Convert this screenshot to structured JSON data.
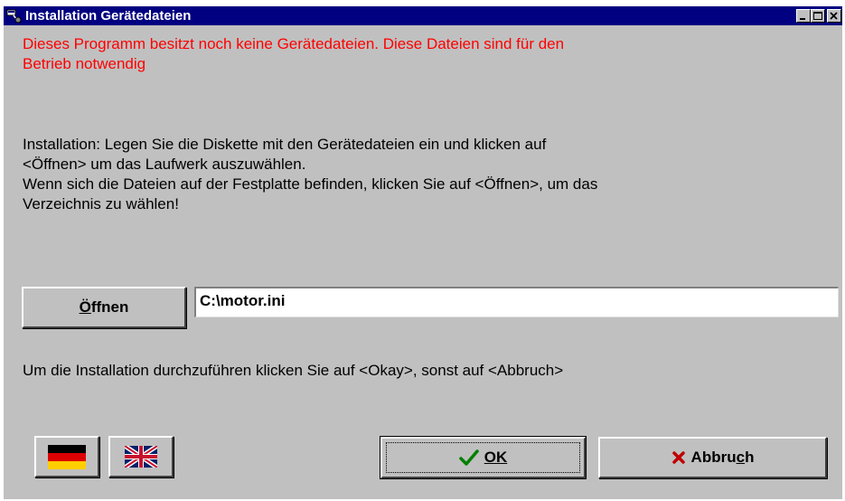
{
  "window": {
    "title": "Installation Gerätedateien",
    "minimize_icon": "minimize-icon",
    "maximize_icon": "maximize-icon",
    "close_icon": "close-icon"
  },
  "warning": {
    "line1": "Dieses Programm besitzt noch keine Gerätedateien. Diese Dateien sind für den",
    "line2": "Betrieb notwendig"
  },
  "instructions": {
    "line1": "Installation: Legen Sie die Diskette mit den Gerätedateien ein und klicken auf",
    "line2": "<Öffnen> um das Laufwerk auszuwählen.",
    "line3": "Wenn sich die Dateien auf der Festplatte befinden, klicken Sie auf <Öffnen>, um das",
    "line4": "Verzeichnis zu wählen!"
  },
  "open_button": {
    "label_mnemonic": "Ö",
    "label_rest": "ffnen"
  },
  "path_field": {
    "value": "C:\\motor.ini"
  },
  "confirm_text": "Um die Installation durchzuführen klicken Sie auf <Okay>, sonst auf <Abbruch>",
  "language_buttons": [
    {
      "flag": "germany-flag-icon",
      "colors": [
        "#000000",
        "#dd0000",
        "#ffce00"
      ]
    },
    {
      "flag": "uk-flag-icon",
      "colors": [
        "#012169",
        "#ffffff",
        "#c8102e"
      ]
    }
  ],
  "ok_button": {
    "icon": "checkmark-icon",
    "label": "OK",
    "icon_color": "#008000"
  },
  "cancel_button": {
    "icon": "x-icon",
    "label_before": "Abbru",
    "label_mnemonic": "c",
    "label_after": "h",
    "icon_color": "#c00000"
  },
  "colors": {
    "title_bar": "#000080",
    "face": "#c0c0c0",
    "warning_text": "#ff0000"
  }
}
